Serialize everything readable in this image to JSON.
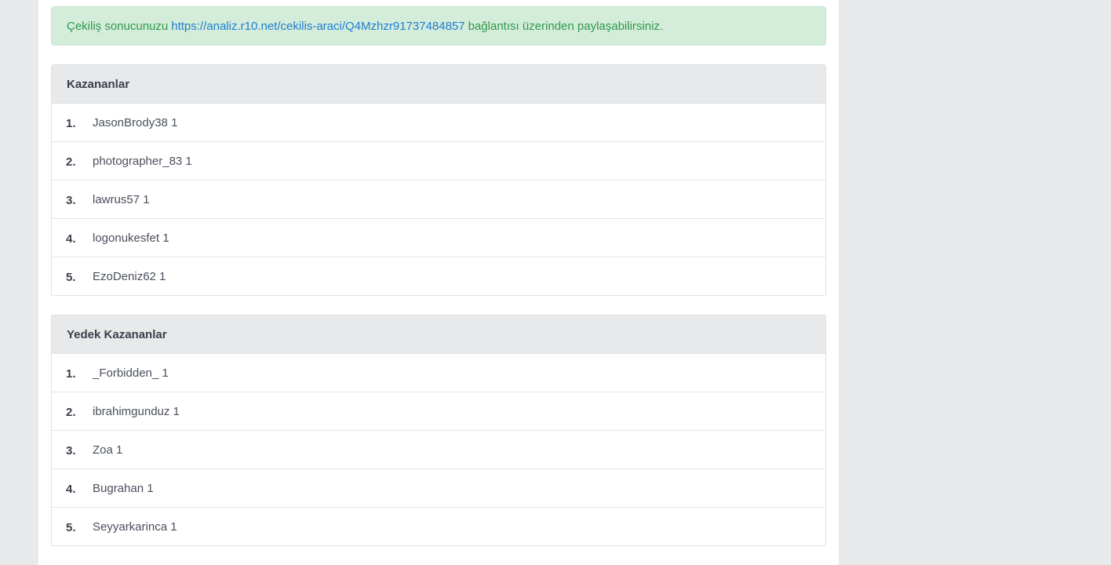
{
  "alert": {
    "prefix": "Çekiliş sonucunuzu",
    "link": "https://analiz.r10.net/cekilis-araci/Q4Mzhzr91737484857",
    "suffix": "bağlantısı üzerinden paylaşabilirsiniz."
  },
  "winners": {
    "title": "Kazananlar",
    "items": [
      {
        "rank": "1.",
        "name": "JasonBrody38 1"
      },
      {
        "rank": "2.",
        "name": "photographer_83 1"
      },
      {
        "rank": "3.",
        "name": "lawrus57 1"
      },
      {
        "rank": "4.",
        "name": "logonukesfet 1"
      },
      {
        "rank": "5.",
        "name": "EzoDeniz62 1"
      }
    ]
  },
  "backups": {
    "title": "Yedek Kazananlar",
    "items": [
      {
        "rank": "1.",
        "name": "_Forbidden_ 1"
      },
      {
        "rank": "2.",
        "name": "ibrahimgunduz 1"
      },
      {
        "rank": "3.",
        "name": "Zoa 1"
      },
      {
        "rank": "4.",
        "name": "Bugrahan 1"
      },
      {
        "rank": "5.",
        "name": "Seyyarkarinca 1"
      }
    ]
  },
  "colors": {
    "alert_text": "#2f9a4c",
    "alert_link": "#1f7fd0",
    "alert_bg": "#d4ecda",
    "card_header_bg": "#e8e9eb",
    "page_bg": "#e8e9eb"
  }
}
